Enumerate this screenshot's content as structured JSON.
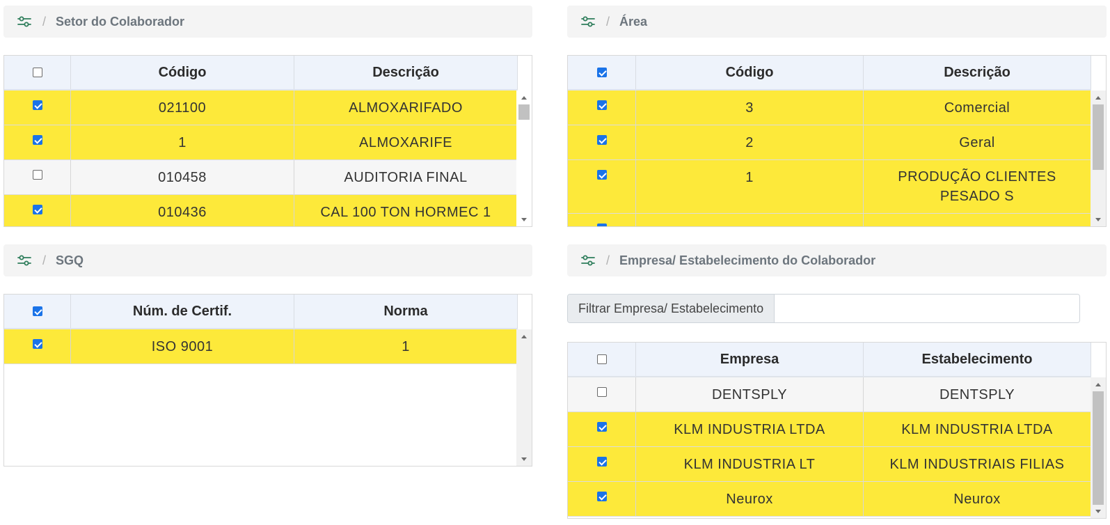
{
  "colors": {
    "selected_row": "#fde93a",
    "accent": "#1a73e8",
    "icon": "#2e7d5b"
  },
  "setor": {
    "breadcrumb_icon": "sliders-icon",
    "breadcrumb_separator": "/",
    "title": "Setor do Colaborador",
    "header_checked": false,
    "columns": [
      "Código",
      "Descrição"
    ],
    "rows": [
      {
        "checked": true,
        "codigo": "021100",
        "descricao": "ALMOXARIFADO"
      },
      {
        "checked": true,
        "codigo": "1",
        "descricao": "ALMOXARIFE"
      },
      {
        "checked": false,
        "codigo": "010458",
        "descricao": "AUDITORIA FINAL"
      },
      {
        "checked": true,
        "codigo": "010436",
        "descricao": "CAL 100 TON HORMEC 1"
      }
    ]
  },
  "area": {
    "breadcrumb_icon": "sliders-icon",
    "breadcrumb_separator": "/",
    "title": "Área",
    "header_checked": true,
    "columns": [
      "Código",
      "Descrição"
    ],
    "rows": [
      {
        "checked": true,
        "codigo": "3",
        "descricao": "Comercial"
      },
      {
        "checked": true,
        "codigo": "2",
        "descricao": "Geral"
      },
      {
        "checked": true,
        "codigo": "1",
        "descricao": "PRODUÇÃO CLIENTES PESADO S"
      }
    ]
  },
  "sgq": {
    "breadcrumb_icon": "sliders-icon",
    "breadcrumb_separator": "/",
    "title": "SGQ",
    "header_checked": true,
    "columns": [
      "Núm. de Certif.",
      "Norma"
    ],
    "rows": [
      {
        "checked": true,
        "certif": "ISO 9001",
        "norma": "1"
      }
    ]
  },
  "empresa": {
    "breadcrumb_icon": "sliders-icon",
    "breadcrumb_separator": "/",
    "title": "Empresa/ Estabelecimento do Colaborador",
    "filter_label": "Filtrar Empresa/ Estabelecimento",
    "filter_value": "",
    "header_checked": false,
    "columns": [
      "Empresa",
      "Estabelecimento"
    ],
    "rows": [
      {
        "checked": false,
        "empresa": "DENTSPLY",
        "estabelecimento": "DENTSPLY"
      },
      {
        "checked": true,
        "empresa": "KLM INDUSTRIA LTDA",
        "estabelecimento": "KLM INDUSTRIA LTDA"
      },
      {
        "checked": true,
        "empresa": "KLM INDUSTRIA LT",
        "estabelecimento": "KLM INDUSTRIAIS FILIAS"
      },
      {
        "checked": true,
        "empresa": "Neurox",
        "estabelecimento": "Neurox"
      }
    ]
  }
}
